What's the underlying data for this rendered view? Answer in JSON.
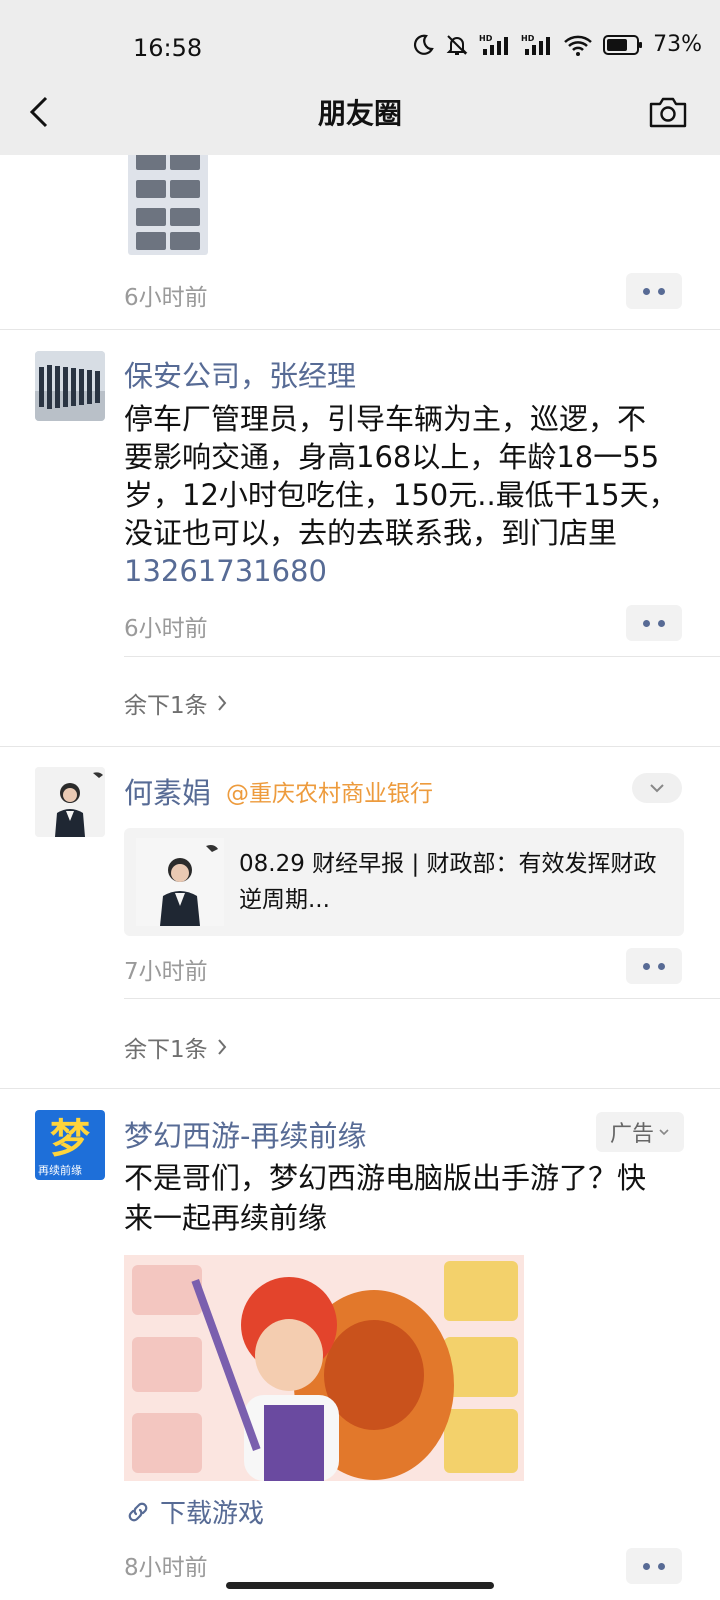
{
  "status_bar": {
    "time": "16:58",
    "battery": "73%"
  },
  "header": {
    "title": "朋友圈"
  },
  "posts": [
    {
      "time": "6小时前"
    },
    {
      "author": "保安公司，张经理",
      "text_lines": [
        "停车厂管理员，引导车辆为主，巡逻，不",
        "要影响交通，身高168以上，年龄18一55",
        "岁，12小时包吃住，150元..最低干15天，",
        "没证也可以，去的去联系我，到门店里"
      ],
      "phone": "13261731680",
      "time": "6小时前",
      "more": "余下1条"
    },
    {
      "author": "何素娟",
      "mention": "@重庆农村商业银行",
      "card_text": "08.29 财经早报 | 财政部：有效发挥财政逆周期...",
      "time": "7小时前",
      "more": "余下1条"
    }
  ],
  "ad": {
    "author": "梦幻西游-再续前缘",
    "badge": "广告",
    "text_lines": [
      "不是哥们，梦幻西游电脑版出手游了？快",
      "来一起再续前缘"
    ],
    "link_label": "下载游戏",
    "time": "8小时前",
    "logo_char": "梦",
    "logo_sub": "再续前缘"
  }
}
